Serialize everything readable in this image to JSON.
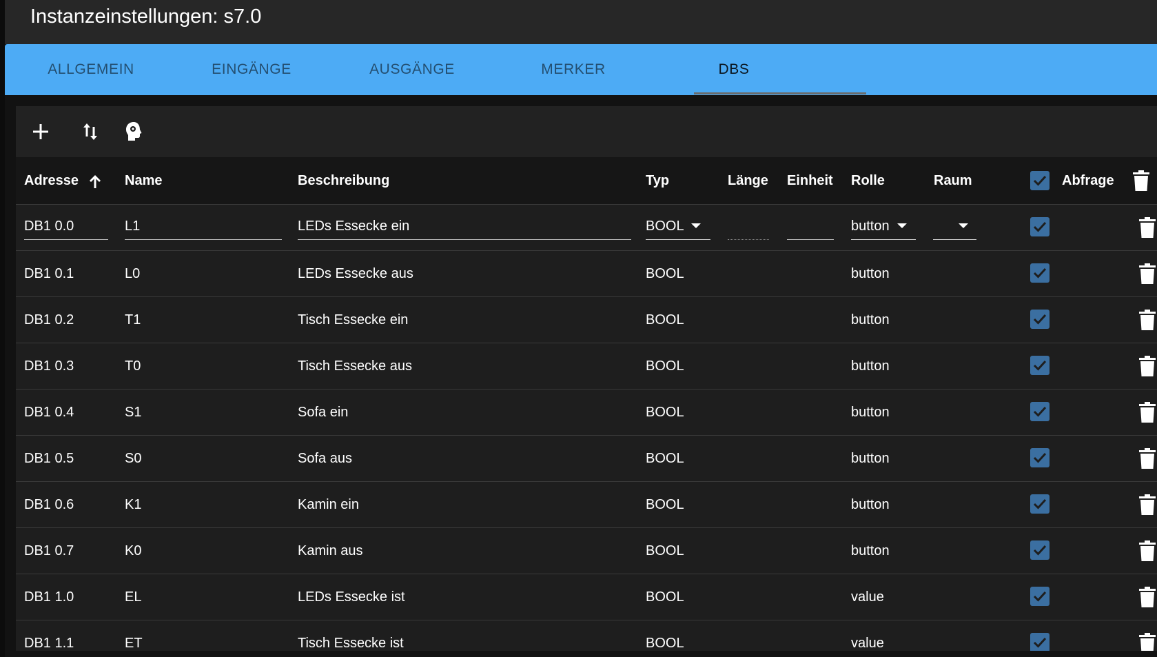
{
  "window": {
    "title": "Instanzeinstellungen: s7.0"
  },
  "tabs": [
    {
      "label": "ALLGEMEIN"
    },
    {
      "label": "EINGÄNGE"
    },
    {
      "label": "AUSGÄNGE"
    },
    {
      "label": "MERKER"
    },
    {
      "label": "DBS",
      "active": true
    }
  ],
  "toolbar": {
    "icons": [
      "plus-icon",
      "sort-arrows-icon",
      "head-icon"
    ]
  },
  "table": {
    "columns": {
      "address": "Adresse",
      "name": "Name",
      "description": "Beschreibung",
      "type": "Typ",
      "length": "Länge",
      "unit": "Einheit",
      "role": "Rolle",
      "room": "Raum",
      "poll": "Abfrage"
    },
    "sort": {
      "column": "Adresse",
      "direction": "ascending"
    },
    "rows": [
      {
        "address": "DB1 0.0",
        "name": "L1",
        "description": "LEDs Essecke ein",
        "type": "BOOL",
        "length": "",
        "unit": "",
        "role": "button",
        "room": "",
        "poll": true,
        "editing": true
      },
      {
        "address": "DB1 0.1",
        "name": "L0",
        "description": "LEDs Essecke aus",
        "type": "BOOL",
        "length": "",
        "unit": "",
        "role": "button",
        "room": "",
        "poll": true
      },
      {
        "address": "DB1 0.2",
        "name": "T1",
        "description": "Tisch Essecke ein",
        "type": "BOOL",
        "length": "",
        "unit": "",
        "role": "button",
        "room": "",
        "poll": true
      },
      {
        "address": "DB1 0.3",
        "name": "T0",
        "description": "Tisch Essecke aus",
        "type": "BOOL",
        "length": "",
        "unit": "",
        "role": "button",
        "room": "",
        "poll": true
      },
      {
        "address": "DB1 0.4",
        "name": "S1",
        "description": "Sofa ein",
        "type": "BOOL",
        "length": "",
        "unit": "",
        "role": "button",
        "room": "",
        "poll": true
      },
      {
        "address": "DB1 0.5",
        "name": "S0",
        "description": "Sofa aus",
        "type": "BOOL",
        "length": "",
        "unit": "",
        "role": "button",
        "room": "",
        "poll": true
      },
      {
        "address": "DB1 0.6",
        "name": "K1",
        "description": "Kamin ein",
        "type": "BOOL",
        "length": "",
        "unit": "",
        "role": "button",
        "room": "",
        "poll": true
      },
      {
        "address": "DB1 0.7",
        "name": "K0",
        "description": "Kamin aus",
        "type": "BOOL",
        "length": "",
        "unit": "",
        "role": "button",
        "room": "",
        "poll": true
      },
      {
        "address": "DB1 1.0",
        "name": "EL",
        "description": "LEDs Essecke ist",
        "type": "BOOL",
        "length": "",
        "unit": "",
        "role": "value",
        "room": "",
        "poll": true
      },
      {
        "address": "DB1 1.1",
        "name": "ET",
        "description": "Tisch Essecke ist",
        "type": "BOOL",
        "length": "",
        "unit": "",
        "role": "value",
        "room": "",
        "poll": true
      }
    ]
  },
  "colors": {
    "tab_bar": "#4dabf5",
    "checkbox": "#3b6fa1",
    "background": "#1e1e1e"
  }
}
